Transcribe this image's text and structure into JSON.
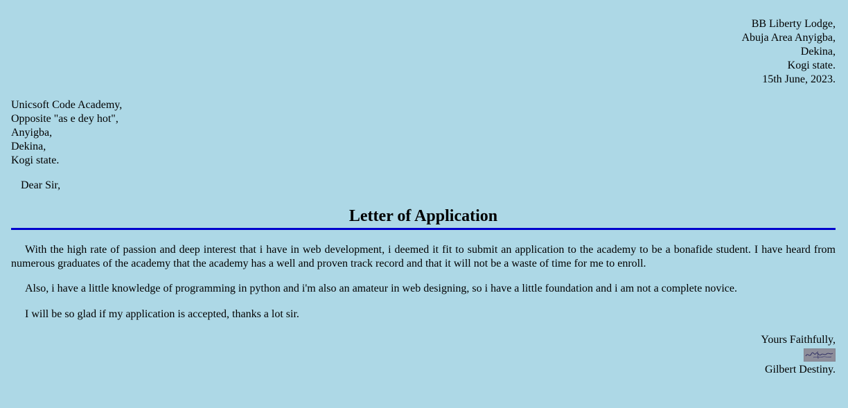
{
  "sender_address": {
    "lines": [
      "BB Liberty Lodge,",
      "Abuja Area Anyigba,",
      "Dekina,",
      "Kogi state.",
      "15th June, 2023."
    ]
  },
  "recipient_address": {
    "lines": [
      "Unicsoft Code Academy,",
      "Opposite \"as e dey hot\",",
      "Anyigba,",
      "Dekina,",
      "Kogi state."
    ]
  },
  "salutation": "Dear Sir,",
  "title": "Letter of Application",
  "paragraphs": [
    "With the high rate of passion and deep interest that i have in web development, i deemed it fit to submit an application to the academy to be a bonafide student. I have heard from numerous graduates of the academy that the academy has a well and proven track record and that it will not be a waste of time for me to enroll.",
    "Also, i have a little knowledge of programming in python and i'm also an amateur in web designing, so i have a little foundation and i am not a complete novice.",
    "I will be so glad if my application is accepted, thanks a lot sir."
  ],
  "closing": {
    "valediction": "Yours Faithfully,",
    "signature_icon": "handwritten-signature-image",
    "name": "Gilbert Destiny."
  },
  "colors": {
    "background": "#add8e6",
    "title_rule": "#0000cd"
  }
}
